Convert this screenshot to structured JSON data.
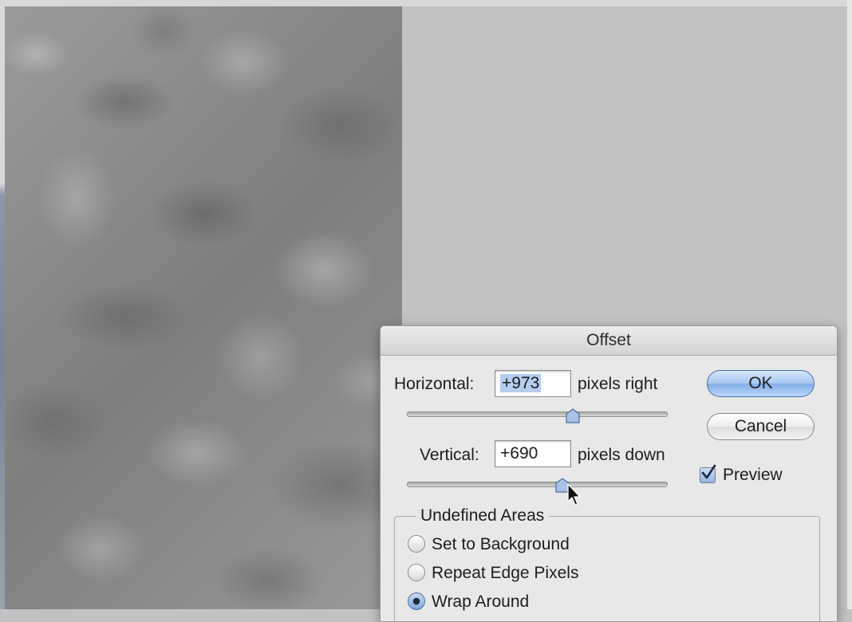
{
  "dialog": {
    "title": "Offset",
    "horizontal": {
      "label": "Horizontal:",
      "value": "+973",
      "unit": "pixels right",
      "slider_level": 0.64
    },
    "vertical": {
      "label": "Vertical:",
      "value": "+690",
      "unit": "pixels down",
      "slider_level": 0.6
    },
    "buttons": {
      "ok": "OK",
      "cancel": "Cancel"
    },
    "preview": {
      "label": "Preview",
      "checked": true
    },
    "undefined_areas": {
      "legend": "Undefined Areas",
      "options": [
        {
          "label": "Set to Background",
          "selected": false
        },
        {
          "label": "Repeat Edge Pixels",
          "selected": false
        },
        {
          "label": "Wrap Around",
          "selected": true
        }
      ]
    }
  },
  "colors": {
    "workspace": "#c2c1c3",
    "dialog_bg": "#e8e8e8",
    "ok_button": "#a6c7f1",
    "selection_highlight": "#b5cdef"
  },
  "icons": {
    "checkmark": "check-icon",
    "cursor": "pointer-cursor-icon"
  }
}
